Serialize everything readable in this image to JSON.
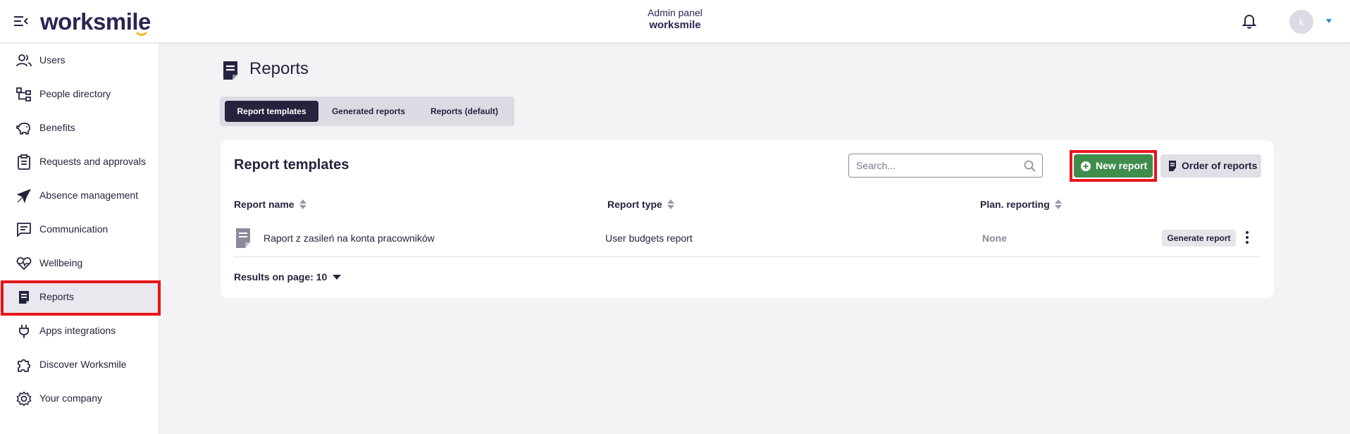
{
  "header": {
    "logo_text": "worksmile",
    "admin_title": "Admin panel",
    "admin_brand": "worksmile",
    "avatar_initial": "k"
  },
  "sidebar": {
    "items": [
      {
        "label": "Users",
        "icon": "users-icon"
      },
      {
        "label": "People directory",
        "icon": "org-chart-icon"
      },
      {
        "label": "Benefits",
        "icon": "piggy-bank-icon"
      },
      {
        "label": "Requests and approvals",
        "icon": "clipboard-icon"
      },
      {
        "label": "Absence management",
        "icon": "airplane-icon"
      },
      {
        "label": "Communication",
        "icon": "message-icon"
      },
      {
        "label": "Wellbeing",
        "icon": "heart-pulse-icon"
      },
      {
        "label": "Reports",
        "icon": "report-icon",
        "active": true
      },
      {
        "label": "Apps integrations",
        "icon": "plug-icon"
      },
      {
        "label": "Discover Worksmile",
        "icon": "puzzle-icon"
      },
      {
        "label": "Your company",
        "icon": "gear-icon"
      }
    ]
  },
  "page": {
    "title": "Reports"
  },
  "tabs": [
    {
      "label": "Report templates",
      "active": true
    },
    {
      "label": "Generated reports",
      "active": false
    },
    {
      "label": "Reports (default)",
      "active": false
    }
  ],
  "card": {
    "title": "Report templates",
    "search_placeholder": "Search...",
    "new_report_label": "New report",
    "order_label": "Order of reports",
    "columns": [
      "Report name",
      "Report type",
      "Plan. reporting"
    ],
    "rows": [
      {
        "name": "Raport z zasileń na konta pracowników",
        "type": "User budgets report",
        "plan": "None",
        "action": "Generate report"
      }
    ],
    "results_per_page_label": "Results on page: 10"
  },
  "colors": {
    "primary_dark": "#26233e",
    "accent_green": "#3f8d4c",
    "highlight_red": "#e8141b",
    "logo_smile": "#f5b400"
  }
}
